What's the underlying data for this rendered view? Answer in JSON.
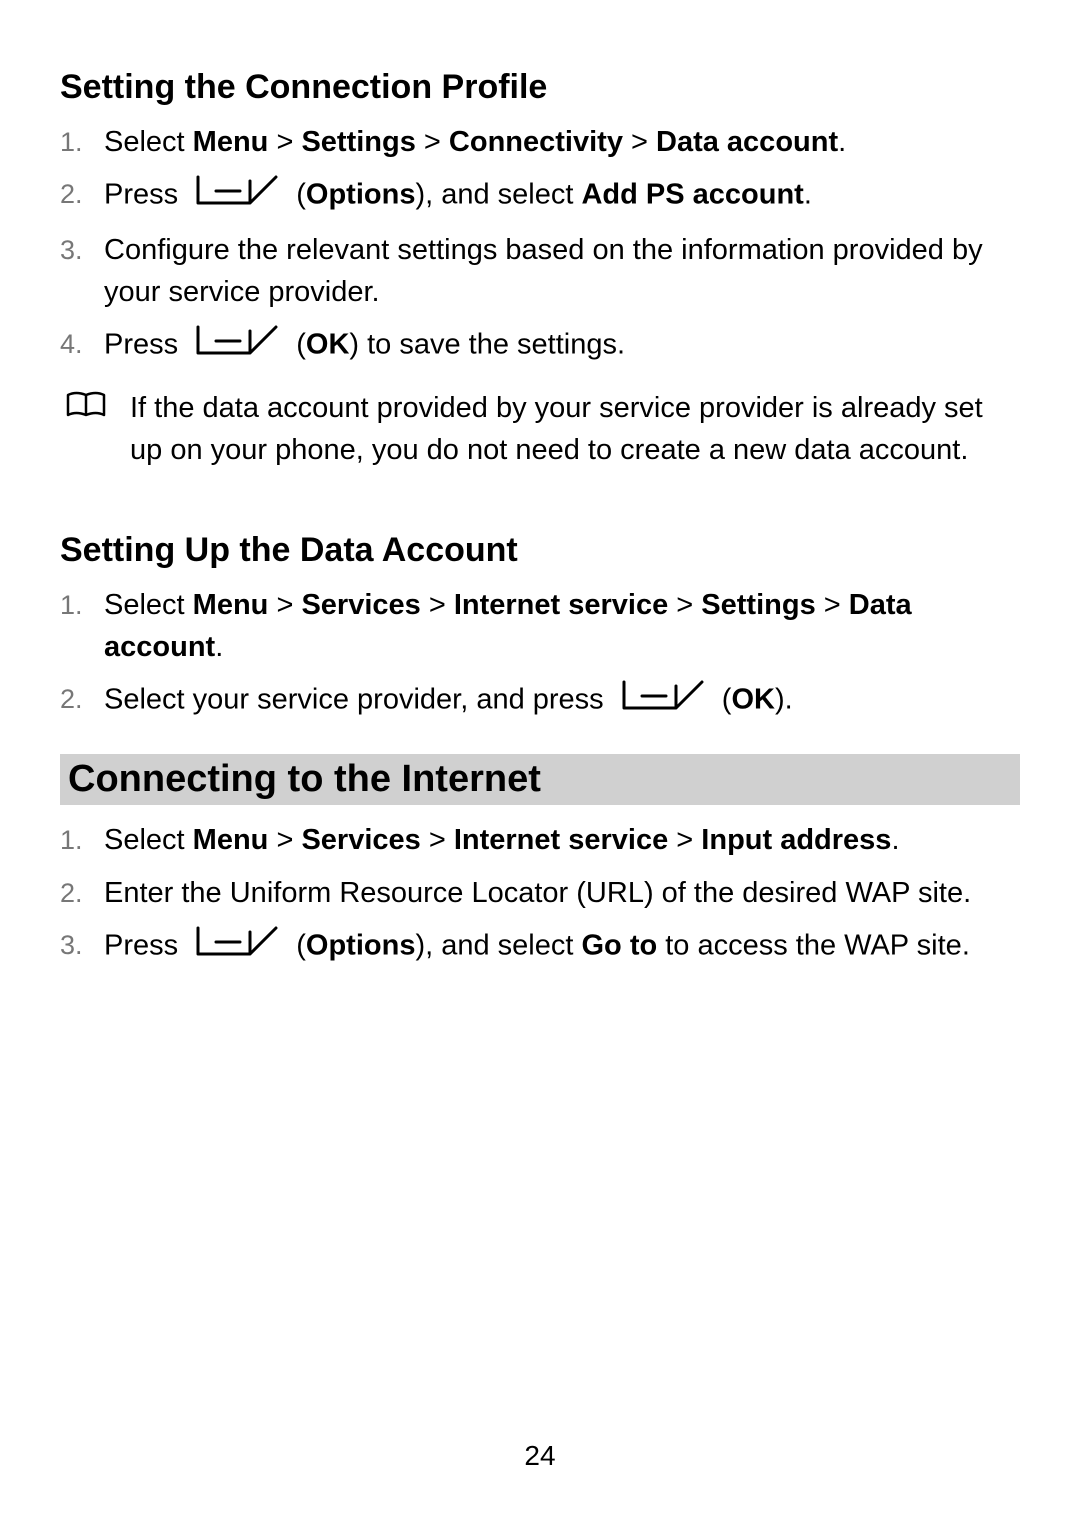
{
  "page_number": "24",
  "s1": {
    "heading": "Setting the Connection Profile",
    "items": {
      "n1": "1.",
      "n2": "2.",
      "n3": "3.",
      "n4": "4.",
      "i1_a": "Select ",
      "i1_menu": "Menu",
      "i1_gt1": " > ",
      "i1_settings": "Settings",
      "i1_gt2": " > ",
      "i1_conn": "Connectivity",
      "i1_gt3": " > ",
      "i1_data": "Data account",
      "i1_dot": ".",
      "i2_a": "Press ",
      "i2_paren_open": " (",
      "i2_options": "Options",
      "i2_paren_close": "), and select ",
      "i2_addps": "Add PS account",
      "i2_dot": ".",
      "i3": "Configure the relevant settings based on the information provided by your service provider.",
      "i4_a": "Press ",
      "i4_paren_open": " (",
      "i4_ok": "OK",
      "i4_paren_close": ") to save the settings."
    },
    "note": "If the data account provided by your service provider is already set up on your phone, you do not need to create a new data account."
  },
  "s2": {
    "heading": "Setting Up the Data Account",
    "items": {
      "n1": "1.",
      "n2": "2.",
      "i1_a": "Select ",
      "i1_menu": "Menu",
      "i1_gt1": " > ",
      "i1_services": "Services",
      "i1_gt2": " > ",
      "i1_internet": "Internet service",
      "i1_gt3": " > ",
      "i1_settings": "Settings",
      "i1_gt4": " > ",
      "i1_data": "Data account",
      "i1_dot": ".",
      "i2_a": "Select your service provider, and press ",
      "i2_paren_open": " (",
      "i2_ok": "OK",
      "i2_paren_close": ")."
    }
  },
  "s3": {
    "heading": "Connecting to the Internet",
    "items": {
      "n1": "1.",
      "n2": "2.",
      "n3": "3.",
      "i1_a": "Select ",
      "i1_menu": "Menu",
      "i1_gt1": " > ",
      "i1_services": "Services",
      "i1_gt2": " > ",
      "i1_internet": "Internet service",
      "i1_gt3": " > ",
      "i1_input": "Input address",
      "i1_dot": ".",
      "i2": "Enter the Uniform Resource Locator (URL) of the desired WAP site.",
      "i3_a": "Press ",
      "i3_paren_open": " (",
      "i3_options": "Options",
      "i3_paren_close": "), and select ",
      "i3_goto": "Go to",
      "i3_b": " to access the WAP site."
    }
  }
}
